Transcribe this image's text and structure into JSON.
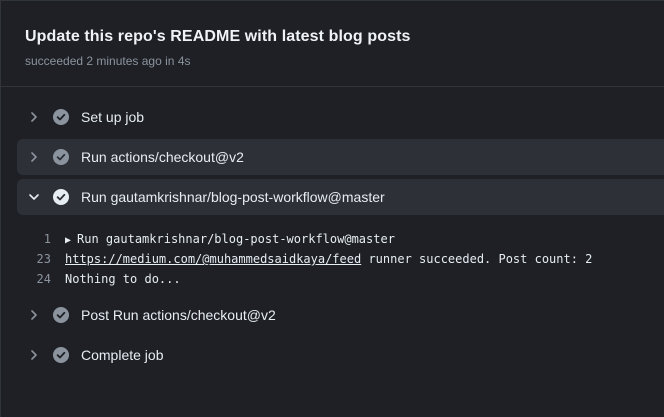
{
  "header": {
    "title": "Update this repo's README with latest blog posts",
    "status": "succeeded",
    "time": "2 minutes ago",
    "duration_prefix": "in",
    "duration": "4s"
  },
  "steps": [
    {
      "label": "Set up job",
      "expanded": false
    },
    {
      "label": "Run actions/checkout@v2",
      "expanded": false
    },
    {
      "label": "Run gautamkrishnar/blog-post-workflow@master",
      "expanded": true
    },
    {
      "label": "Post Run actions/checkout@v2",
      "expanded": false
    },
    {
      "label": "Complete job",
      "expanded": false
    }
  ],
  "log": {
    "lines": [
      {
        "number": "1",
        "text": "Run gautamkrishnar/blog-post-workflow@master"
      },
      {
        "number": "23",
        "link": "https://medium.com/@muhammedsaidkaya/feed",
        "text": " runner succeeded. Post count: 2"
      },
      {
        "number": "24",
        "text": "Nothing to do..."
      }
    ]
  },
  "colors": {
    "background": "#1e2025",
    "highlight": "#2d3036",
    "check": "#8b949e",
    "check_active": "#e6edf3"
  }
}
